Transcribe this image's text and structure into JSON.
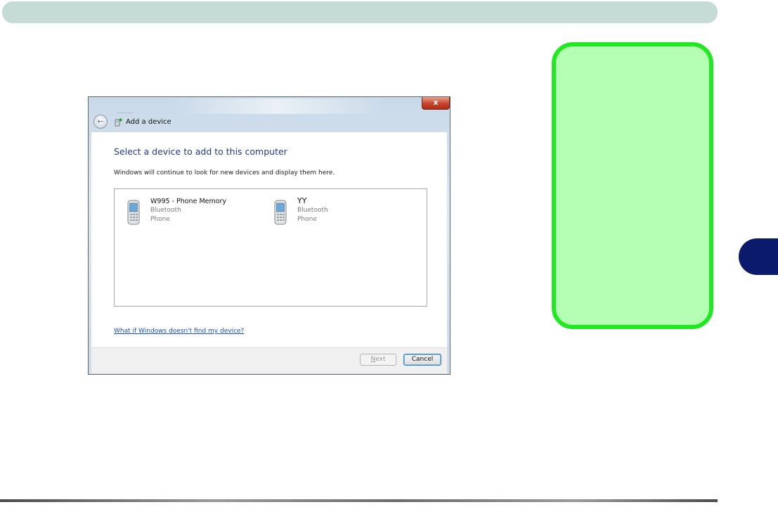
{
  "dialog": {
    "close_label": "x",
    "title": "Add a device",
    "heading": "Select a device to add to this computer",
    "subtext": "Windows will continue to look for new devices and display them here.",
    "devices": [
      {
        "name": "W995 - Phone Memory",
        "type": "Bluetooth",
        "category": "Phone"
      },
      {
        "name": "YY",
        "type": "Bluetooth",
        "category": "Phone"
      }
    ],
    "help_link": "What if Windows doesn't find my device?",
    "next_label_accel": "N",
    "next_label_rest": "ext",
    "cancel_label": "Cancel"
  },
  "colors": {
    "header_bar": "#c5dcd6",
    "note_border": "#21e821",
    "note_fill": "#b4ffb4",
    "chapter_tab": "#0c1a6c",
    "heading_text": "#1f3b8a",
    "link": "#1a4fc2"
  },
  "icons": [
    "back-arrow-icon",
    "add-device-icon",
    "close-icon",
    "phone-icon"
  ]
}
